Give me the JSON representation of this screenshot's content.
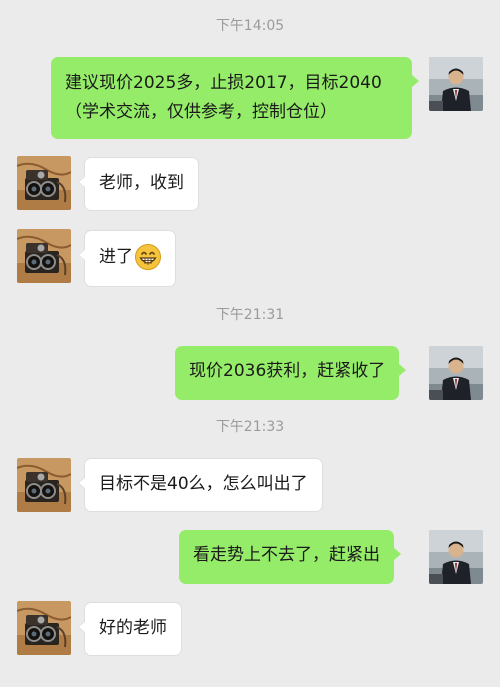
{
  "chat": {
    "timestamps": [
      "下午14:05",
      "下午21:31",
      "下午21:33"
    ],
    "messages": [
      {
        "sender": "me",
        "lines": [
          "建议现价2025多，止损2017，目标2040",
          "（学术交流，仅供参考，控制仓位）"
        ]
      },
      {
        "sender": "other",
        "text": "老师，收到"
      },
      {
        "sender": "other",
        "text": "进了",
        "emoji": "grinning-face-emoji"
      },
      {
        "sender": "me",
        "text": "现价2036获利，赶紧收了"
      },
      {
        "sender": "other",
        "text": "目标不是40么，怎么叫出了"
      },
      {
        "sender": "me",
        "text": "看走势上不去了，赶紧出"
      },
      {
        "sender": "other",
        "text": "好的老师"
      }
    ]
  },
  "colors": {
    "background": "#ebebeb",
    "outgoing_bubble": "#95ec69",
    "incoming_bubble": "#ffffff",
    "timestamp": "#9b9b9b"
  },
  "icons": {
    "my_avatar": "man-in-suit-photo",
    "other_avatar": "vintage-camera-photo"
  }
}
